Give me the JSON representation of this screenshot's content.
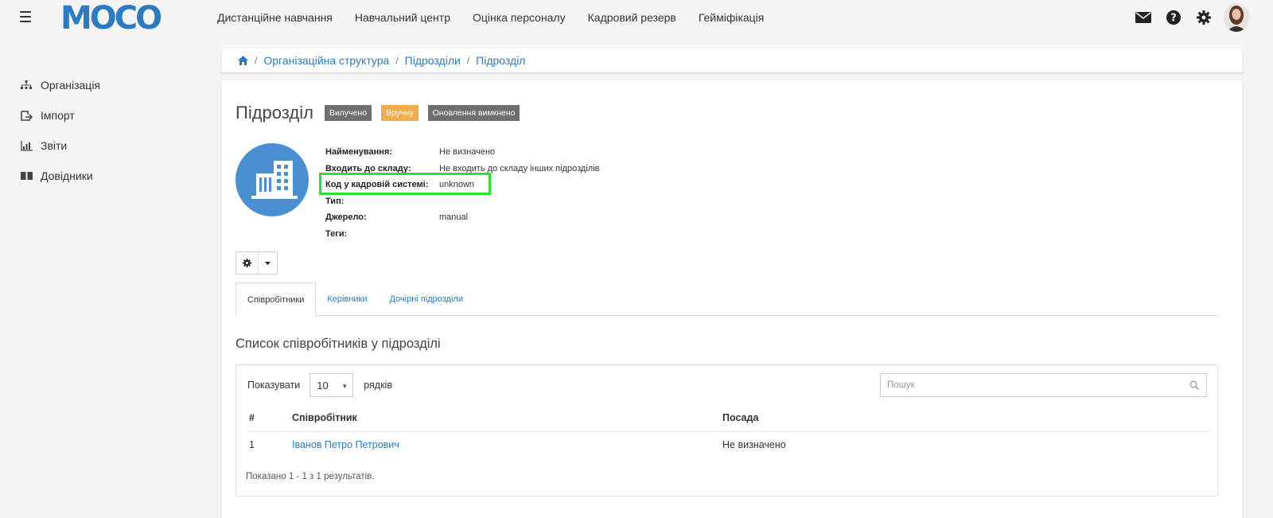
{
  "app": {
    "logo_text": "MOCO",
    "brand_color": "#2a7bc2",
    "accent_highlight": "#2ee02e"
  },
  "nav": {
    "items": [
      {
        "label": "Дистанційне навчання"
      },
      {
        "label": "Навчальний центр"
      },
      {
        "label": "Оцінка персоналу"
      },
      {
        "label": "Кадровий резерв"
      },
      {
        "label": "Гейміфікація"
      }
    ],
    "icons": [
      "envelope-icon",
      "help-icon",
      "gear-icon",
      "avatar"
    ]
  },
  "sidebar": {
    "items": [
      {
        "label": "Організація",
        "icon": "org-chart-icon"
      },
      {
        "label": "Імпорт",
        "icon": "import-icon"
      },
      {
        "label": "Звіти",
        "icon": "reports-icon"
      },
      {
        "label": "Довідники",
        "icon": "book-icon"
      }
    ]
  },
  "breadcrumb": {
    "items": [
      "Організаційна структура",
      "Підрозділи",
      "Підрозділ"
    ]
  },
  "page": {
    "title": "Підрозділ",
    "badges": [
      "Вилучено",
      "Вручну",
      "Оновлення вимкнено"
    ]
  },
  "details": {
    "name_label": "Найменування:",
    "name_value": "Не визначено",
    "part_of_label": "Входить до складу:",
    "part_of_value": "Не входить до складу інших підрозділів",
    "hr_code_label": "Код у кадровій системі:",
    "hr_code_value": "unknown",
    "type_label": "Тип:",
    "type_value": "",
    "source_label": "Джерело:",
    "source_value": "manual",
    "tags_label": "Теги:",
    "tags_value": ""
  },
  "tabs": [
    {
      "label": "Співробітники",
      "active": true
    },
    {
      "label": "Керівники",
      "active": false
    },
    {
      "label": "Дочірні підрозділи",
      "active": false
    }
  ],
  "employees": {
    "title": "Список співробітників у підрозділі",
    "show_label": "Показувати",
    "rows_value": "10",
    "rows_label": "рядків",
    "search_placeholder": "Пошук",
    "columns": [
      "#",
      "Співробітник",
      "Посада"
    ],
    "rows": [
      {
        "num": "1",
        "name": "Іванов Петро Петрович",
        "position": "Не визначено"
      }
    ],
    "summary": "Показано 1 - 1 з 1 результатів."
  }
}
